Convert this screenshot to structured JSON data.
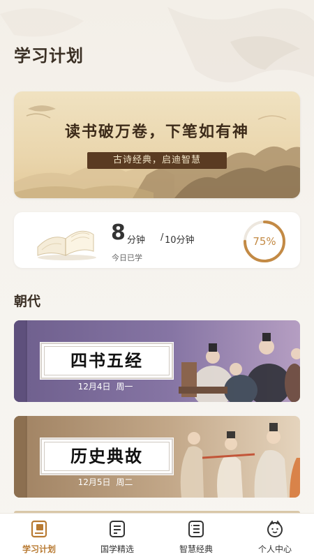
{
  "page": {
    "title": "学习计划"
  },
  "banner": {
    "title": "读书破万卷，下笔如有神",
    "subtitle": "古诗经典，启迪智慧"
  },
  "progress": {
    "minutes_done": "8",
    "minutes_unit": "分钟",
    "separator": "/",
    "goal": "10分钟",
    "label": "今日已学",
    "percent_text": "75%",
    "percent_value": 0.75,
    "ring_color": "#c38a45"
  },
  "section": {
    "title": "朝代"
  },
  "courses": [
    {
      "title": "四书五经",
      "date": "12月4日",
      "weekday": "周一",
      "theme_color": "#7a6a96"
    },
    {
      "title": "历史典故",
      "date": "12月5日",
      "weekday": "周二",
      "theme_color": "#a88b6c"
    }
  ],
  "nav": {
    "items": [
      {
        "label": "学习计划",
        "icon": "book-icon",
        "active": true
      },
      {
        "label": "国学精选",
        "icon": "document-icon",
        "active": false
      },
      {
        "label": "智慧经典",
        "icon": "list-icon",
        "active": false
      },
      {
        "label": "个人中心",
        "icon": "face-icon",
        "active": false
      }
    ],
    "active_color": "#b87a32"
  }
}
